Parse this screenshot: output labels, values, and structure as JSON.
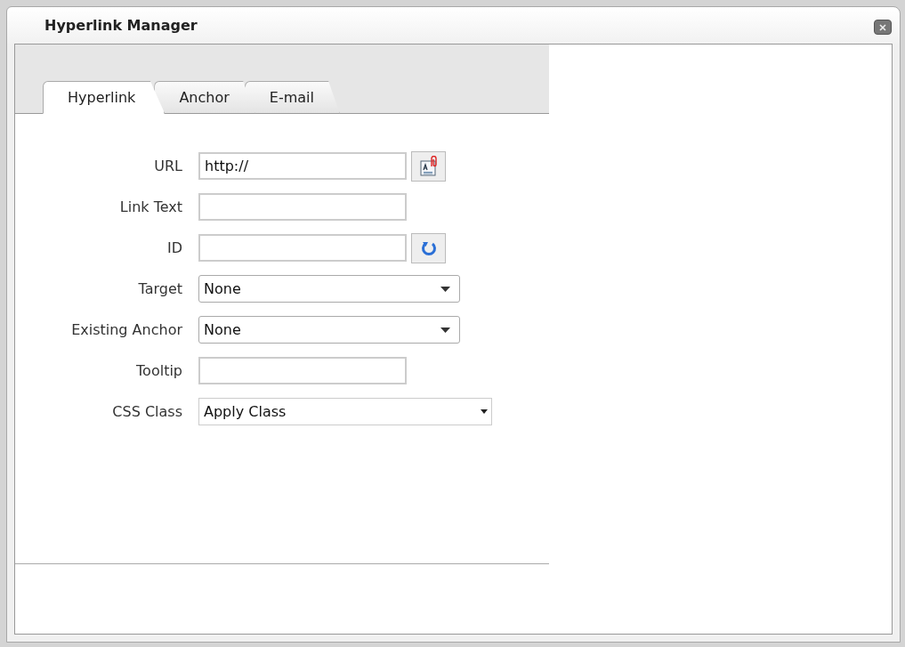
{
  "window": {
    "title": "Hyperlink Manager"
  },
  "tabs": [
    {
      "label": "Hyperlink",
      "selected": true
    },
    {
      "label": "Anchor",
      "selected": false
    },
    {
      "label": "E-mail",
      "selected": false
    }
  ],
  "fields": [
    {
      "kind": "text",
      "label": "URL",
      "value": "http://",
      "button": {
        "kind": "document"
      }
    },
    {
      "kind": "text",
      "label": "Link Text"
    },
    {
      "kind": "text",
      "label": "ID",
      "button": {
        "kind": "refresh"
      }
    },
    {
      "kind": "select",
      "label": "Target",
      "value": "None"
    },
    {
      "kind": "select",
      "label": "Existing Anchor",
      "value": "None"
    },
    {
      "kind": "text",
      "label": "Tooltip"
    },
    {
      "kind": "wide-select",
      "label": "CSS Class",
      "value": "Apply Class"
    }
  ]
}
